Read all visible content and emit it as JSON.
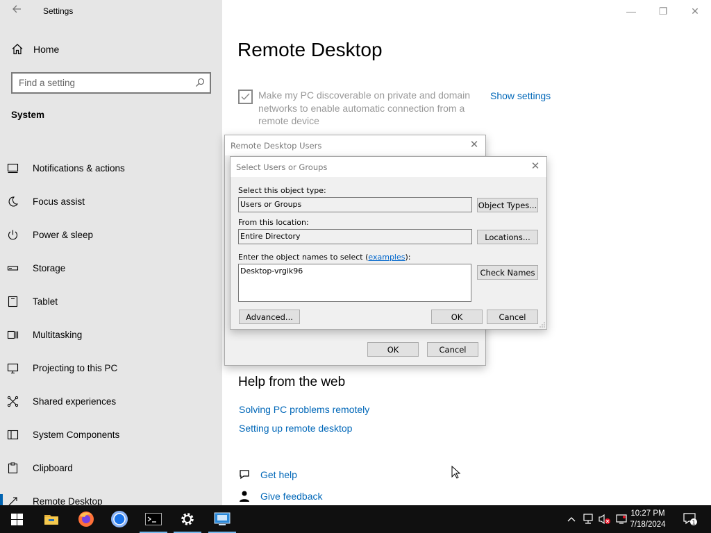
{
  "window": {
    "title": "Settings",
    "minimize": "—",
    "restore": "❐",
    "close": "✕"
  },
  "sidebar": {
    "home": "Home",
    "search_placeholder": "Find a setting",
    "section": "System",
    "items": [
      {
        "label": "Notifications & actions",
        "icon": "notifications-icon"
      },
      {
        "label": "Focus assist",
        "icon": "moon-icon"
      },
      {
        "label": "Power & sleep",
        "icon": "power-icon"
      },
      {
        "label": "Storage",
        "icon": "storage-icon"
      },
      {
        "label": "Tablet",
        "icon": "tablet-icon"
      },
      {
        "label": "Multitasking",
        "icon": "multitasking-icon"
      },
      {
        "label": "Projecting to this PC",
        "icon": "projector-icon"
      },
      {
        "label": "Shared experiences",
        "icon": "shared-icon"
      },
      {
        "label": "System Components",
        "icon": "components-icon"
      },
      {
        "label": "Clipboard",
        "icon": "clipboard-icon"
      },
      {
        "label": "Remote Desktop",
        "icon": "remote-desktop-icon",
        "active": true
      }
    ]
  },
  "main": {
    "title": "Remote Desktop",
    "discoverable": {
      "text": "Make my PC discoverable on private and domain networks to enable automatic connection from a remote device",
      "checked": true,
      "link": "Show settings"
    },
    "help": {
      "title": "Help from the web",
      "links": [
        "Solving PC problems remotely",
        "Setting up remote desktop"
      ]
    },
    "footer": {
      "get_help": "Get help",
      "give_feedback": "Give feedback"
    }
  },
  "dialog_users": {
    "title": "Remote Desktop Users",
    "ok": "OK",
    "cancel": "Cancel"
  },
  "dialog_select": {
    "title": "Select Users or Groups",
    "object_type_label": "Select this object type:",
    "object_type_value": "Users or Groups",
    "object_types_button": "Object Types...",
    "location_label": "From this location:",
    "location_value": "Entire Directory",
    "locations_button": "Locations...",
    "names_label_prefix": "Enter the object names to select (",
    "names_label_link": "examples",
    "names_label_suffix": "):",
    "names_value": "Desktop-vrgik96",
    "check_names_button": "Check Names",
    "advanced_button": "Advanced...",
    "ok": "OK",
    "cancel": "Cancel"
  },
  "taskbar": {
    "apps": [
      "start-icon",
      "file-explorer-icon",
      "firefox-icon",
      "chrome-icon",
      "terminal-icon",
      "settings-icon",
      "remote-desktop-app-icon"
    ],
    "clock_time": "10:27 PM",
    "clock_date": "7/18/2024",
    "notification_count": "1"
  },
  "colors": {
    "accent": "#0067b8",
    "sidebar_bg": "#e6e6e6",
    "taskbar_bg": "#101010",
    "dialog_bg": "#f0f0f0"
  }
}
